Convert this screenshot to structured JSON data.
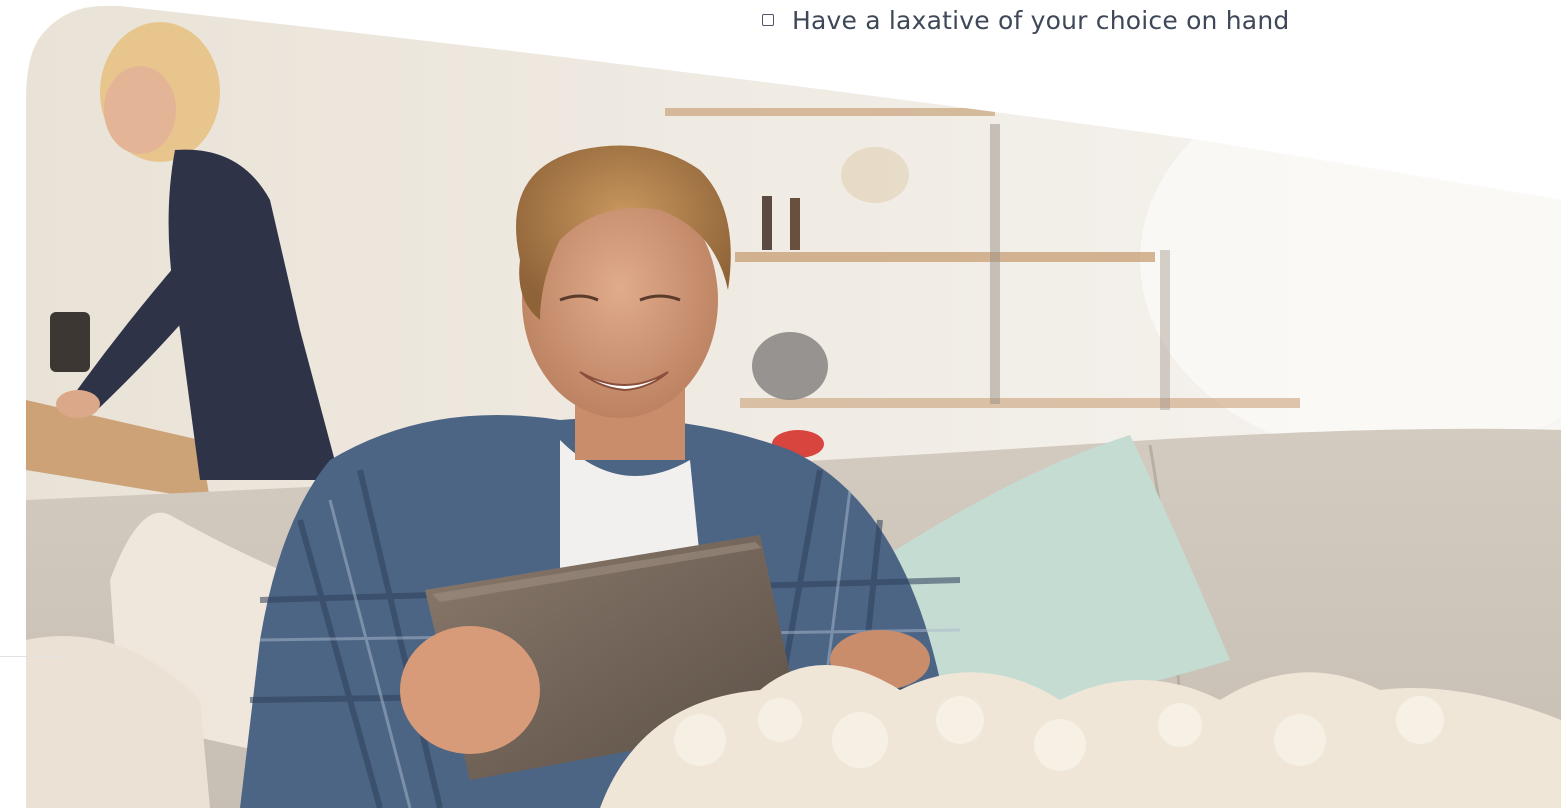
{
  "checklist": {
    "items": [
      {
        "label": "Have a laxative of your choice on hand",
        "checked": false
      }
    ]
  },
  "hero_image": {
    "description_icon": "photo-man-smiling-with-tablet-on-sofa"
  },
  "colors": {
    "text": "#3e4858",
    "background": "#ffffff"
  }
}
